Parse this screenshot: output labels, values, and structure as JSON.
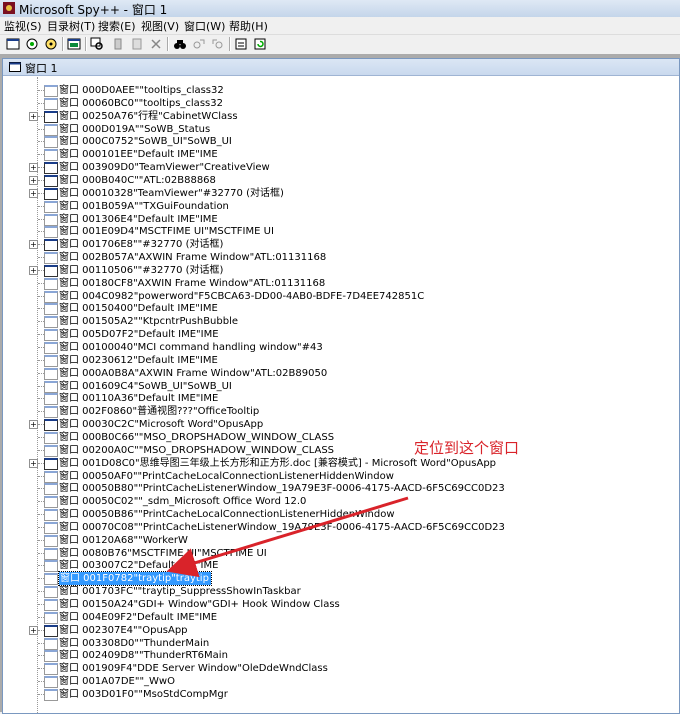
{
  "window": {
    "title": "Microsoft Spy++ - 窗口 1"
  },
  "menu": [
    "监视(S)",
    "目录树(T)",
    "搜索(E)",
    "视图(V)",
    "窗口(W)",
    "帮助(H)"
  ],
  "toolbar_icons": [
    "windows-icon",
    "processes-icon",
    "threads-icon",
    "messages-icon",
    "find-window-icon",
    "start-logging-icon",
    "stop-logging-icon",
    "clear-icon",
    "find-icon",
    "find-next-icon",
    "find-prev-icon",
    "properties-icon",
    "refresh-icon"
  ],
  "child_window": {
    "title": "窗口 1"
  },
  "tree_rows": [
    {
      "label": "窗口 000D0AEE\"\"tooltips_class32",
      "expand": ""
    },
    {
      "label": "窗口 00060BC0\"\"tooltips_class32",
      "expand": ""
    },
    {
      "label": "窗口 00250A76\"行程\"CabinetWClass",
      "expand": "+"
    },
    {
      "label": "窗口 000D019A\"\"SoWB_Status",
      "expand": ""
    },
    {
      "label": "窗口 000C0752\"SoWB_UI\"SoWB_UI",
      "expand": ""
    },
    {
      "label": "窗口 000101EE\"Default IME\"IME",
      "expand": ""
    },
    {
      "label": "窗口 003909D0\"TeamViewer\"CreativeView",
      "expand": "+"
    },
    {
      "label": "窗口 000B040C\"\"ATL:02B88868",
      "expand": "+"
    },
    {
      "label": "窗口 00010328\"TeamViewer\"#32770 (对话框)",
      "expand": "+"
    },
    {
      "label": "窗口 001B059A\"\"TXGuiFoundation",
      "expand": ""
    },
    {
      "label": "窗口 001306E4\"Default IME\"IME",
      "expand": ""
    },
    {
      "label": "窗口 001E09D4\"MSCTFIME UI\"MSCTFIME UI",
      "expand": ""
    },
    {
      "label": "窗口 001706E8\"\"#32770 (对话框)",
      "expand": "+"
    },
    {
      "label": "窗口 002B057A\"AXWIN Frame Window\"ATL:01131168",
      "expand": ""
    },
    {
      "label": "窗口 00110506\"\"#32770 (对话框)",
      "expand": "+"
    },
    {
      "label": "窗口 00180CF8\"AXWIN Frame Window\"ATL:01131168",
      "expand": ""
    },
    {
      "label": "窗口 004C0982\"powerword\"F5CBCA63-DD00-4AB0-BDFE-7D4EE742851C",
      "expand": ""
    },
    {
      "label": "窗口 00150400\"Default IME\"IME",
      "expand": ""
    },
    {
      "label": "窗口 001505A2\"\"KtpcntrPushBubble",
      "expand": ""
    },
    {
      "label": "窗口 005D07F2\"Default IME\"IME",
      "expand": ""
    },
    {
      "label": "窗口 00100040\"MCI command handling window\"#43",
      "expand": ""
    },
    {
      "label": "窗口 00230612\"Default IME\"IME",
      "expand": ""
    },
    {
      "label": "窗口 000A0B8A\"AXWIN Frame Window\"ATL:02B89050",
      "expand": ""
    },
    {
      "label": "窗口 001609C4\"SoWB_UI\"SoWB_UI",
      "expand": ""
    },
    {
      "label": "窗口 00110A36\"Default IME\"IME",
      "expand": ""
    },
    {
      "label": "窗口 002F0860\"普通视图???\"OfficeTooltip",
      "expand": ""
    },
    {
      "label": "窗口 00030C2C\"Microsoft Word\"OpusApp",
      "expand": "+"
    },
    {
      "label": "窗口 000B0C66\"\"MSO_DROPSHADOW_WINDOW_CLASS",
      "expand": ""
    },
    {
      "label": "窗口 00200A0C\"\"MSO_DROPSHADOW_WINDOW_CLASS",
      "expand": ""
    },
    {
      "label": "窗口 001D08C0\"思维导图三年级上长方形和正方形.doc [兼容模式] - Microsoft Word\"OpusApp",
      "expand": "+"
    },
    {
      "label": "窗口 00050AF0\"\"PrintCacheLocalConnectionListenerHiddenWindow",
      "expand": ""
    },
    {
      "label": "窗口 00050B80\"\"PrintCacheListenerWindow_19A79E3F-0006-4175-AACD-6F5C69CC0D23",
      "expand": ""
    },
    {
      "label": "窗口 00050C02\"\"_sdm_Microsoft Office Word 12.0",
      "expand": ""
    },
    {
      "label": "窗口 00050B86\"\"PrintCacheLocalConnectionListenerHiddenWindow",
      "expand": ""
    },
    {
      "label": "窗口 00070C08\"\"PrintCacheListenerWindow_19A79E3F-0006-4175-AACD-6F5C69CC0D23",
      "expand": ""
    },
    {
      "label": "窗口 00120A68\"\"WorkerW",
      "expand": ""
    },
    {
      "label": "窗口 0080B76\"MSCTFIME UI\"MSCTFIME UI",
      "expand": ""
    },
    {
      "label": "窗口 003007C2\"Default IME\"IME",
      "expand": ""
    },
    {
      "label": "窗口 001F0782\"traytip\"traytip",
      "expand": "",
      "selected": true
    },
    {
      "label": "窗口 001703FC\"\"traytip_SuppressShowInTaskbar",
      "expand": ""
    },
    {
      "label": "窗口 00150A24\"GDI+ Window\"GDI+ Hook Window Class",
      "expand": ""
    },
    {
      "label": "窗口 004E09F2\"Default IME\"IME",
      "expand": ""
    },
    {
      "label": "窗口 002307E4\"\"OpusApp",
      "expand": "+"
    },
    {
      "label": "窗口 003308D0\"\"ThunderMain",
      "expand": ""
    },
    {
      "label": "窗口 002409D8\"\"ThunderRT6Main",
      "expand": ""
    },
    {
      "label": "窗口 001909F4\"DDE Server Window\"OleDdeWndClass",
      "expand": ""
    },
    {
      "label": "窗口 001A07DE\"\"_WwO",
      "expand": ""
    },
    {
      "label": "窗口 003D01F0\"\"MsoStdCompMgr",
      "expand": ""
    }
  ],
  "annotation": {
    "text": "定位到这个窗口",
    "color": "#d9232a"
  }
}
